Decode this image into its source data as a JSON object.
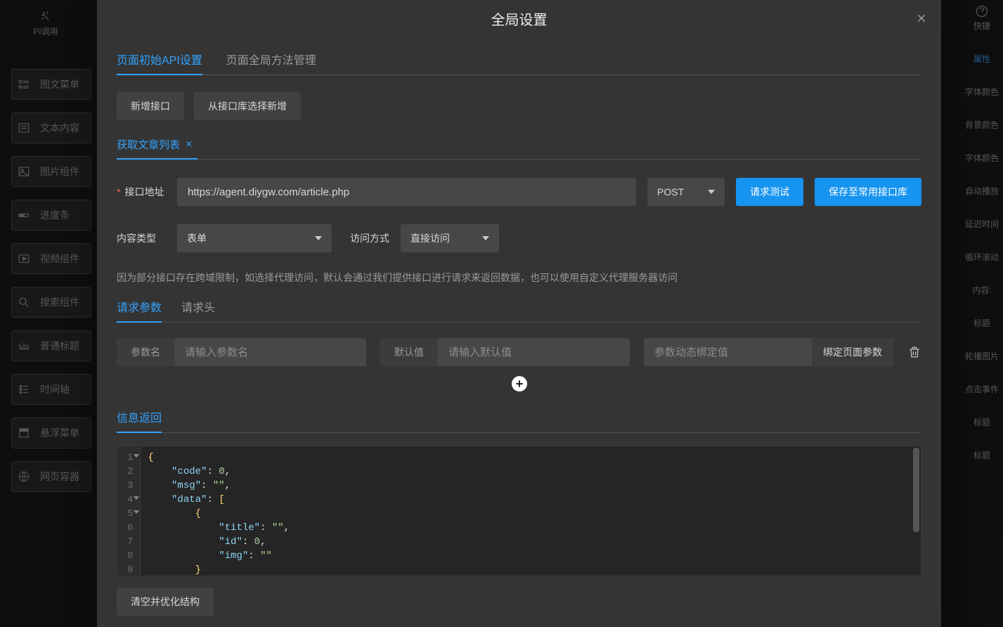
{
  "topbar": {
    "left_label": "PI调用",
    "right_label": "快捷",
    "help_icon": "help"
  },
  "left_widgets": [
    {
      "icon": "list",
      "label": "图文菜单"
    },
    {
      "icon": "text",
      "label": "文本内容"
    },
    {
      "icon": "image",
      "label": "图片组件"
    },
    {
      "icon": "progress",
      "label": "进度条"
    },
    {
      "icon": "video",
      "label": "视频组件"
    },
    {
      "icon": "search",
      "label": "搜索组件"
    },
    {
      "icon": "heading",
      "label": "普通标题"
    },
    {
      "icon": "timeline",
      "label": "时间轴"
    },
    {
      "icon": "float",
      "label": "悬浮菜单"
    },
    {
      "icon": "web",
      "label": "网页容器"
    }
  ],
  "right_props": {
    "active": "属性",
    "items": [
      "字体颜色",
      "背景颜色",
      "字体颜色",
      "自动播放",
      "延迟时间",
      "循环滚动",
      "内容:",
      "标题",
      "轮播图片",
      "点击事件",
      "标题",
      "标题"
    ]
  },
  "dialog": {
    "title": "全局设置",
    "close": "×"
  },
  "outer_tabs": [
    {
      "label": "页面初始API设置",
      "active": true
    },
    {
      "label": "页面全局方法管理",
      "active": false
    }
  ],
  "action_buttons": {
    "add_api": "新增接口",
    "add_from_lib": "从接口库选择新增"
  },
  "api_tab": {
    "name": "获取文章列表"
  },
  "url_row": {
    "label": "接口地址",
    "value": "https://agent.diygw.com/article.php",
    "method": "POST",
    "test": "请求测试",
    "save": "保存至常用接口库"
  },
  "content_row": {
    "content_type_label": "内容类型",
    "content_type_value": "表单",
    "access_label": "访问方式",
    "access_value": "直接访问"
  },
  "note": "因为部分接口存在跨域限制，如选择代理访问，默认会通过我们提供接口进行请求来返回数据，也可以使用自定义代理服务器访问",
  "subtabs": [
    {
      "label": "请求参数",
      "active": true
    },
    {
      "label": "请求头",
      "active": false
    }
  ],
  "param_row": {
    "name_label": "参数名",
    "name_placeholder": "请输入参数名",
    "default_label": "默认值",
    "default_placeholder": "请输入默认值",
    "dynamic_placeholder": "参数动态绑定值",
    "bind_button": "绑定页面参数"
  },
  "response": {
    "title": "信息返回",
    "clear_button": "清空并优化结构",
    "code_lines": [
      "{",
      "    \"code\": 0,",
      "    \"msg\": \"\",",
      "    \"data\": [",
      "        {",
      "            \"title\": \"\",",
      "            \"id\": 0,",
      "            \"img\": \"\"",
      "        }"
    ]
  }
}
